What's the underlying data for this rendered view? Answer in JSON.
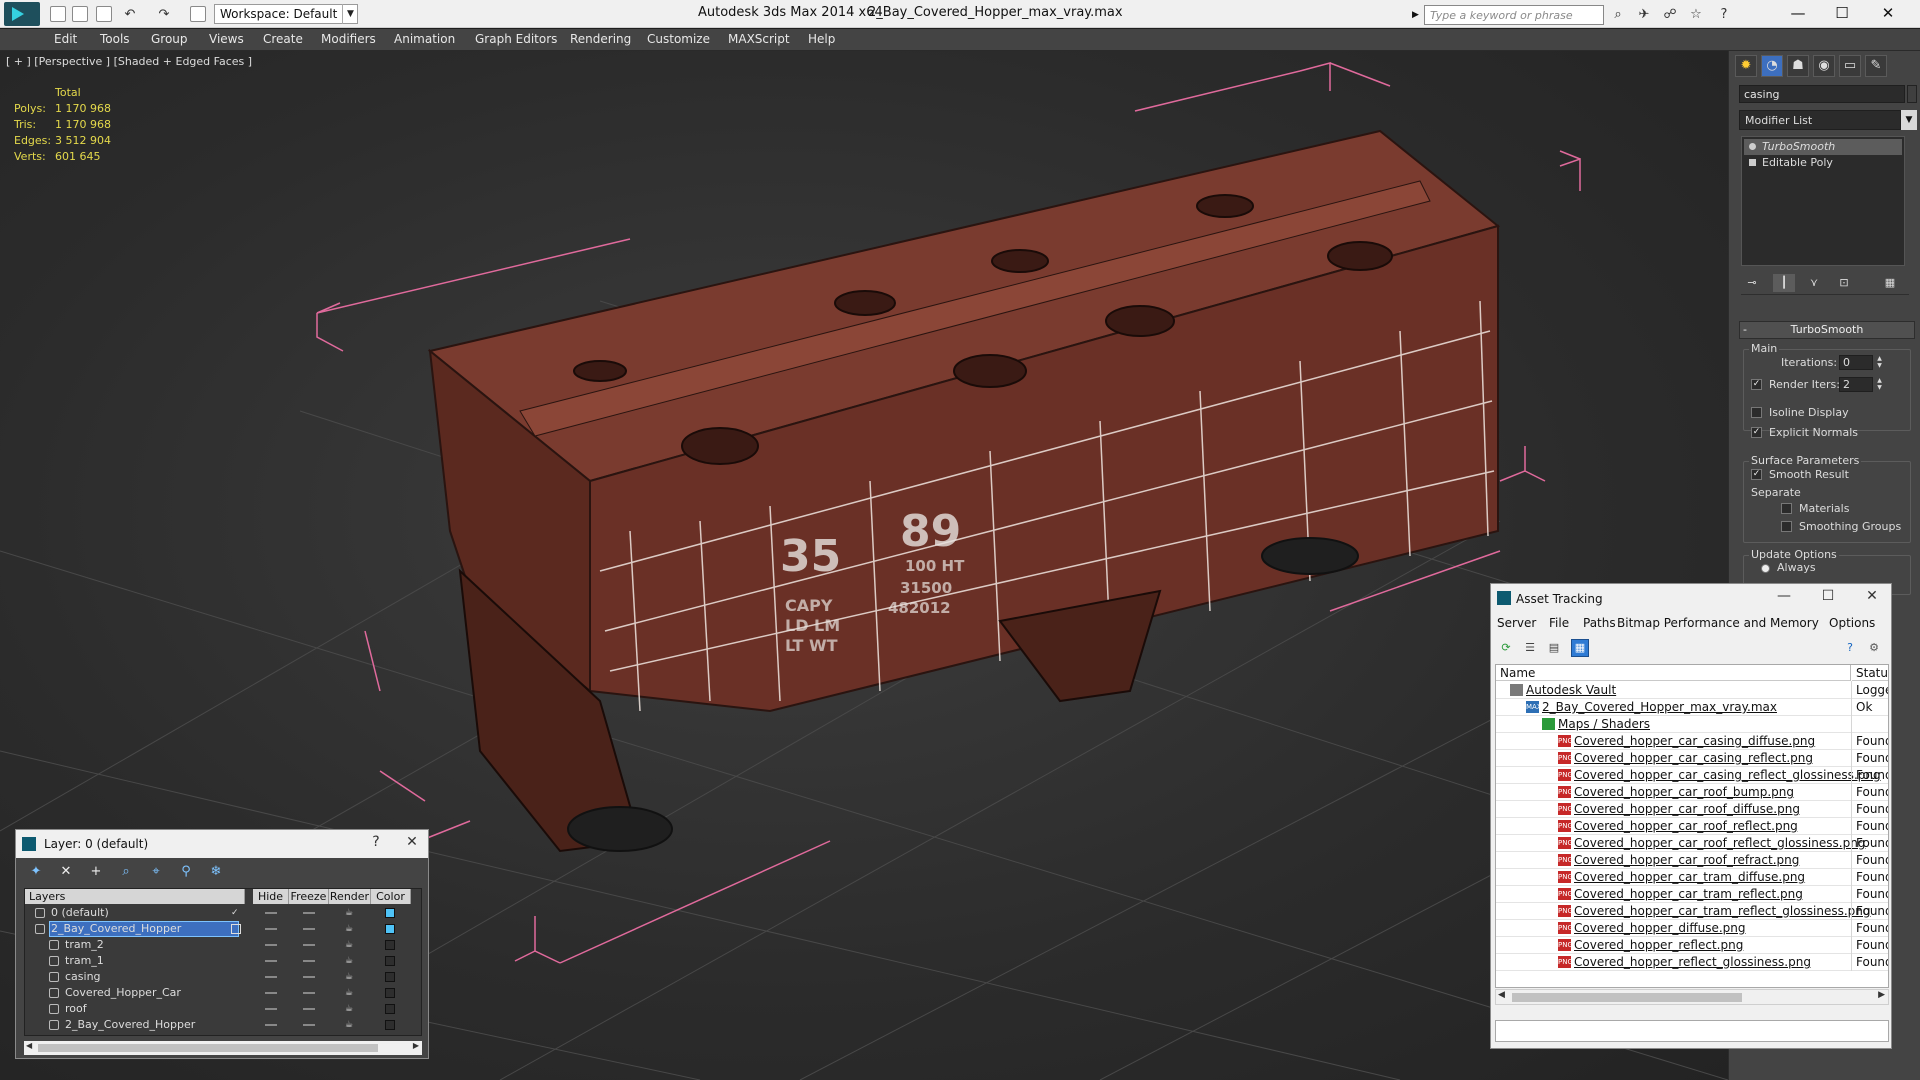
{
  "titlebar": {
    "workspace": "Workspace: Default",
    "app_title": "Autodesk 3ds Max  2014 x64",
    "file_title": "2_Bay_Covered_Hopper_max_vray.max",
    "search_placeholder": "Type a keyword or phrase"
  },
  "menu": [
    "Edit",
    "Tools",
    "Group",
    "Views",
    "Create",
    "Modifiers",
    "Animation",
    "Graph Editors",
    "Rendering",
    "Customize",
    "MAXScript",
    "Help"
  ],
  "viewport": {
    "label": "[ + ] [Perspective ] [Shaded + Edged Faces ]",
    "stats_header": "Total",
    "stats": [
      {
        "label": "Polys:",
        "value": "1 170 968"
      },
      {
        "label": "Tris:",
        "value": "1 170 968"
      },
      {
        "label": "Edges:",
        "value": "3 512 904"
      },
      {
        "label": "Verts:",
        "value": "601 645"
      }
    ],
    "car_lettering": [
      "35",
      "89",
      "CAPY",
      "LD LM",
      "LT WT",
      "100 HT",
      "31500",
      "482012"
    ]
  },
  "command_panel": {
    "object_name": "casing",
    "modifier_list": "Modifier List",
    "stack": [
      "TurboSmooth",
      "Editable Poly"
    ],
    "rollout_title": "TurboSmooth",
    "main_group": "Main",
    "iterations_label": "Iterations:",
    "iterations_value": "0",
    "render_iters_label": "Render Iters:",
    "render_iters_value": "2",
    "isoline_label": "Isoline Display",
    "explicit_label": "Explicit Normals",
    "surface_group": "Surface Parameters",
    "smooth_result_label": "Smooth Result",
    "separate_label": "Separate",
    "materials_label": "Materials",
    "smoothing_groups_label": "Smoothing Groups",
    "update_group": "Update Options",
    "always_label": "Always",
    "colors": {
      "accent": "#3d6fbf",
      "stats": "#e4d94b",
      "bbox": "#e06a9c"
    }
  },
  "asset_tracking": {
    "title": "Asset Tracking",
    "menu": [
      "Server",
      "File",
      "Paths",
      "Bitmap Performance and Memory",
      "Options"
    ],
    "col_name": "Name",
    "col_status": "Status",
    "rows": [
      {
        "name": "Autodesk Vault",
        "status": "Logge",
        "level": 0,
        "icon": "vault"
      },
      {
        "name": "2_Bay_Covered_Hopper_max_vray.max",
        "status": "Ok",
        "level": 1,
        "icon": "max"
      },
      {
        "name": "Maps / Shaders",
        "status": "",
        "level": 2,
        "icon": "maps"
      },
      {
        "name": "Covered_hopper_car_casing_diffuse.png",
        "status": "Found",
        "level": 3,
        "icon": "png"
      },
      {
        "name": "Covered_hopper_car_casing_reflect.png",
        "status": "Found",
        "level": 3,
        "icon": "png"
      },
      {
        "name": "Covered_hopper_car_casing_reflect_glossiness.png",
        "status": "Found",
        "level": 3,
        "icon": "png"
      },
      {
        "name": "Covered_hopper_car_roof_bump.png",
        "status": "Found",
        "level": 3,
        "icon": "png"
      },
      {
        "name": "Covered_hopper_car_roof_diffuse.png",
        "status": "Found",
        "level": 3,
        "icon": "png"
      },
      {
        "name": "Covered_hopper_car_roof_reflect.png",
        "status": "Found",
        "level": 3,
        "icon": "png"
      },
      {
        "name": "Covered_hopper_car_roof_reflect_glossiness.png",
        "status": "Found",
        "level": 3,
        "icon": "png"
      },
      {
        "name": "Covered_hopper_car_roof_refract.png",
        "status": "Found",
        "level": 3,
        "icon": "png"
      },
      {
        "name": "Covered_hopper_car_tram_diffuse.png",
        "status": "Found",
        "level": 3,
        "icon": "png"
      },
      {
        "name": "Covered_hopper_car_tram_reflect.png",
        "status": "Found",
        "level": 3,
        "icon": "png"
      },
      {
        "name": "Covered_hopper_car_tram_reflect_glossiness.png",
        "status": "Found",
        "level": 3,
        "icon": "png"
      },
      {
        "name": "Covered_hopper_diffuse.png",
        "status": "Found",
        "level": 3,
        "icon": "png"
      },
      {
        "name": "Covered_hopper_reflect.png",
        "status": "Found",
        "level": 3,
        "icon": "png"
      },
      {
        "name": "Covered_hopper_reflect_glossiness.png",
        "status": "Found",
        "level": 3,
        "icon": "png"
      }
    ]
  },
  "layer_manager": {
    "title": "Layer: 0 (default)",
    "help": "?",
    "columns": [
      "Layers",
      "Hide",
      "Freeze",
      "Render",
      "Color"
    ],
    "rows": [
      {
        "name": "0 (default)",
        "level": 0,
        "color": "#4fc3f7",
        "checked": true
      },
      {
        "name": "2_Bay_Covered_Hopper",
        "level": 0,
        "color": "#4fc3f7",
        "selected": true
      },
      {
        "name": "tram_2",
        "level": 1,
        "color": "#2e2e2e"
      },
      {
        "name": "tram_1",
        "level": 1,
        "color": "#2e2e2e"
      },
      {
        "name": "casing",
        "level": 1,
        "color": "#2e2e2e"
      },
      {
        "name": "Covered_Hopper_Car",
        "level": 1,
        "color": "#2e2e2e"
      },
      {
        "name": "roof",
        "level": 1,
        "color": "#2e2e2e"
      },
      {
        "name": "2_Bay_Covered_Hopper",
        "level": 1,
        "color": "#2e2e2e"
      }
    ]
  }
}
